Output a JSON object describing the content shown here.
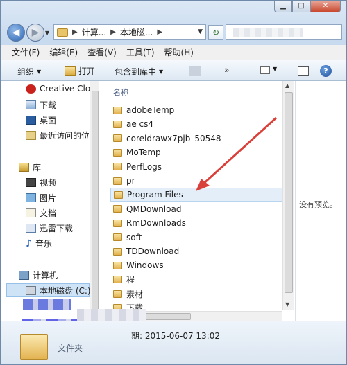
{
  "address": {
    "crumbs": [
      "计算...",
      "本地磁..."
    ]
  },
  "menu": [
    "文件(F)",
    "编辑(E)",
    "查看(V)",
    "工具(T)",
    "帮助(H)"
  ],
  "toolbar": {
    "organize": "组织",
    "open": "打开",
    "include_library": "包含到库中",
    "more": "»"
  },
  "nav": {
    "favorites": [
      "Creative Clo",
      "下载",
      "桌面",
      "最近访问的位"
    ],
    "library": "库",
    "library_items": [
      "视频",
      "图片",
      "文档",
      "迅雷下载",
      "音乐"
    ],
    "computer": "计算机",
    "local_disk": "本地磁盘 (C:)"
  },
  "filelist": {
    "column_name": "名称",
    "items": [
      "adobeTemp",
      "ae cs4",
      "coreldrawx7pjb_50548",
      "MoTemp",
      "PerfLogs",
      "pr",
      "Program Files",
      "QMDownload",
      "RmDownloads",
      "soft",
      "TDDownload",
      "Windows",
      "程",
      "素材",
      "下载"
    ],
    "selected_index": 6
  },
  "preview": {
    "message": "没有预览。"
  },
  "details": {
    "date": "期: 2015-06-07 13:02",
    "type": "文件夹"
  },
  "colors": {
    "arrow": "#d9403a",
    "selection": "#e3eef9"
  }
}
